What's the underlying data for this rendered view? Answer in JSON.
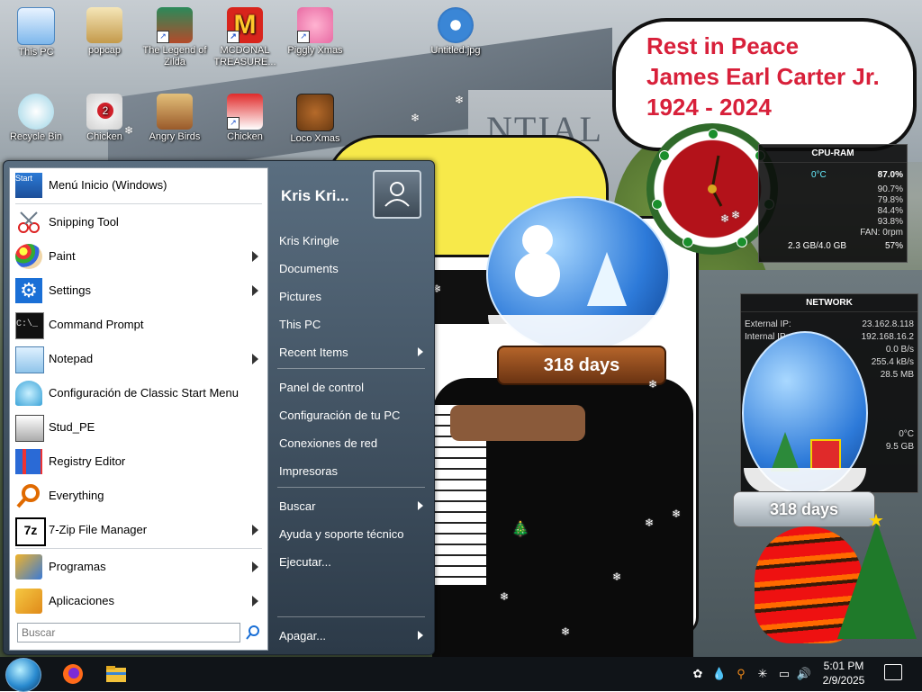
{
  "desktop": {
    "icons": [
      {
        "id": "this-pc",
        "label": "This PC"
      },
      {
        "id": "popcap",
        "label": "popcap"
      },
      {
        "id": "legend-of-zilda",
        "label": "The Legend of Zilda"
      },
      {
        "id": "mcdonald",
        "label": "MCDONAL TREASURE..."
      },
      {
        "id": "piggly-xmas",
        "label": "Piggly Xmas"
      },
      {
        "id": "untitled-jpg",
        "label": "Untitled.jpg"
      },
      {
        "id": "recycle-bin",
        "label": "Recycle Bin"
      },
      {
        "id": "chicken-1",
        "label": "Chicken"
      },
      {
        "id": "angry-birds",
        "label": "Angry Birds"
      },
      {
        "id": "chicken-2",
        "label": "Chicken"
      },
      {
        "id": "loco-xmas",
        "label": "Loco Xmas"
      }
    ],
    "chicken_badge": "2"
  },
  "wallpaper": {
    "building_text": "NTIAL",
    "tribute": {
      "line1": "Rest in Peace",
      "line2": "James Earl Carter Jr.",
      "line3": "1924 - 2024"
    }
  },
  "widgets": {
    "cpu_ram": {
      "title": "CPU-RAM",
      "temp": "0°C",
      "cpu_total": "87.0%",
      "cores": [
        "90.7%",
        "79.8%",
        "84.4%",
        "93.8%"
      ],
      "fan": "FAN: 0rpm",
      "ram": "2.3 GB/4.0 GB",
      "ram_pct": "57%"
    },
    "network": {
      "title": "NETWORK",
      "external_ip_label": "External IP:",
      "external_ip": "23.162.8.118",
      "internal_ip_label": "Internal IP:",
      "internal_ip": "192.168.16.2",
      "upload": "0.0 B/s",
      "download": "255.4 kB/s",
      "total": "28.5 MB",
      "temp": "0°C",
      "disk": "9.5 GB"
    },
    "globe_counter": "318 days"
  },
  "start_menu": {
    "search_placeholder": "Buscar",
    "left_items": [
      {
        "label": "Menú Inicio (Windows)",
        "icon": "start-menu-icon"
      },
      {
        "label": "Snipping Tool",
        "icon": "scissors-icon"
      },
      {
        "label": "Paint",
        "icon": "palette-icon",
        "submenu": true
      },
      {
        "label": "Settings",
        "icon": "gear-icon",
        "submenu": true
      },
      {
        "label": "Command Prompt",
        "icon": "terminal-icon"
      },
      {
        "label": "Notepad",
        "icon": "notepad-icon",
        "submenu": true
      },
      {
        "label": "Configuración de Classic Start Menu",
        "icon": "shell-icon"
      },
      {
        "label": "Stud_PE",
        "icon": "pe-file-icon"
      },
      {
        "label": "Registry Editor",
        "icon": "registry-icon"
      },
      {
        "label": "Everything",
        "icon": "magnifier-icon"
      },
      {
        "label": "7-Zip File Manager",
        "icon": "7zip-icon",
        "submenu": true
      },
      {
        "label": "Programas",
        "icon": "programs-icon",
        "submenu": true
      },
      {
        "label": "Aplicaciones",
        "icon": "apps-icon",
        "submenu": true
      }
    ],
    "user_name": "Kris Kri...",
    "right_items": [
      {
        "label": "Kris Kringle"
      },
      {
        "label": "Documents"
      },
      {
        "label": "Pictures"
      },
      {
        "label": "This PC"
      },
      {
        "label": "Recent Items",
        "submenu": true
      },
      {
        "label": "Panel de control"
      },
      {
        "label": "Configuración de tu PC"
      },
      {
        "label": "Conexiones de red"
      },
      {
        "label": "Impresoras"
      },
      {
        "label": "Buscar",
        "submenu": true
      },
      {
        "label": "Ayuda y soporte técnico"
      },
      {
        "label": "Ejecutar..."
      },
      {
        "label": "Apagar...",
        "submenu": true
      }
    ]
  },
  "taskbar": {
    "time": "5:01 PM",
    "date": "2/9/2025"
  }
}
